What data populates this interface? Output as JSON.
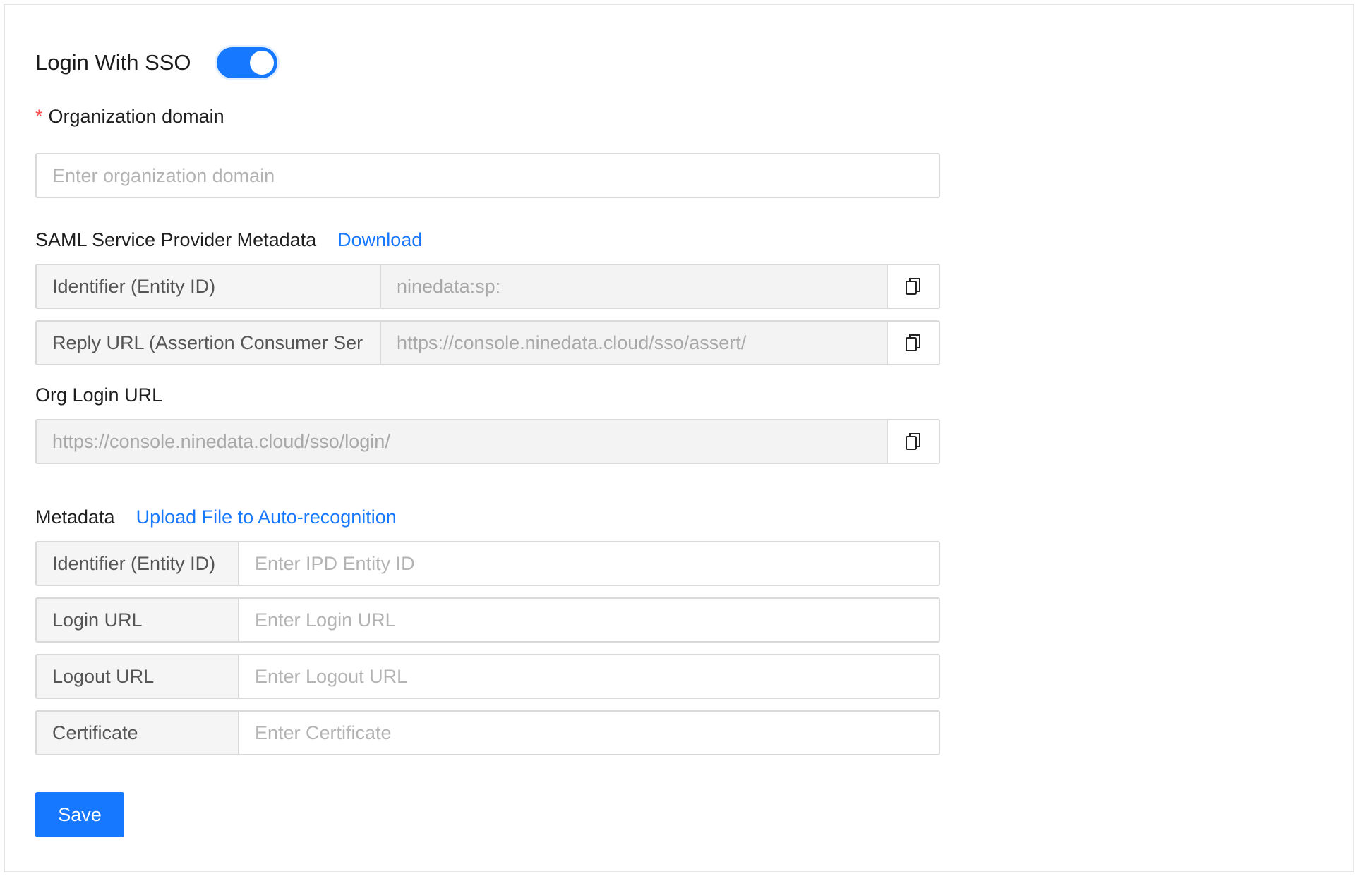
{
  "sso": {
    "title": "Login With SSO",
    "enabled": true
  },
  "org_domain": {
    "required_mark": "*",
    "label": "Organization domain",
    "placeholder": "Enter organization domain"
  },
  "saml": {
    "label": "SAML Service Provider Metadata",
    "download_label": "Download",
    "rows": [
      {
        "label": "Identifier (Entity ID)",
        "value": "ninedata:sp:"
      },
      {
        "label": "Reply URL (Assertion Consumer Ser",
        "value": "https://console.ninedata.cloud/sso/assert/"
      }
    ]
  },
  "org_login": {
    "label": "Org Login URL",
    "value": "https://console.ninedata.cloud/sso/login/"
  },
  "metadata": {
    "label": "Metadata",
    "upload_label": "Upload File to Auto-recognition",
    "rows": [
      {
        "label": "Identifier (Entity ID)",
        "placeholder": "Enter IPD Entity ID"
      },
      {
        "label": "Login URL",
        "placeholder": "Enter Login URL"
      },
      {
        "label": "Logout URL",
        "placeholder": "Enter Logout URL"
      },
      {
        "label": "Certificate",
        "placeholder": "Enter Certificate"
      }
    ]
  },
  "save_label": "Save",
  "colors": {
    "accent": "#1677ff",
    "required": "#ff4d4f"
  },
  "icons": {
    "copy": "copy-icon"
  }
}
